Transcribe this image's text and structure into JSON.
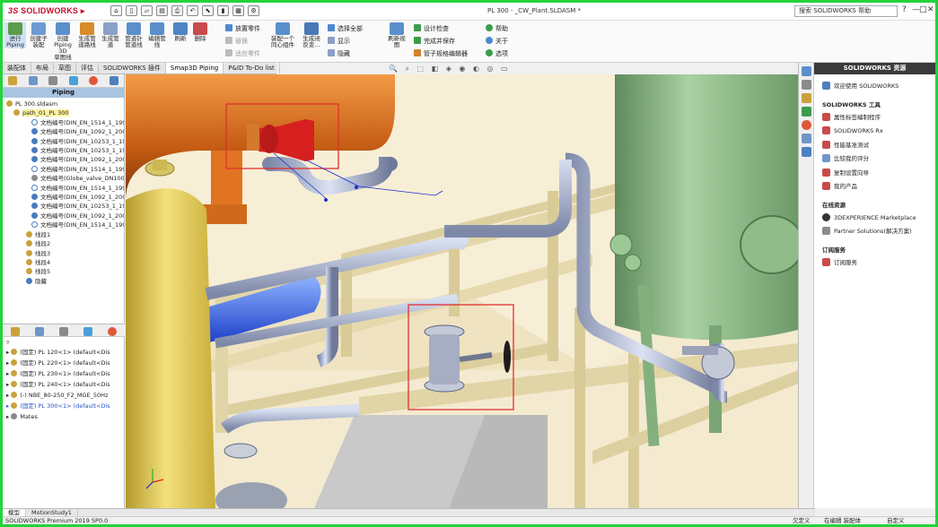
{
  "app": {
    "logo_ds": "3S",
    "logo_name": "SOLIDWORKS",
    "document_title": "PL 300 - _CW_Plant.SLDASM *",
    "search_placeholder": "搜索 SOLIDWORKS 帮助",
    "window_buttons": [
      "?",
      "—",
      "□",
      "✕"
    ]
  },
  "ribbon": {
    "buttons": [
      "进行\nPiping",
      "创建子\n装配",
      "创建\nPiping 3D\n草图线",
      "生成管\n道路线",
      "生成管\n道",
      "管道针\n管道线",
      "编辑管\n线",
      "刷新",
      "删除"
    ],
    "group1": [
      "放置零件",
      "替换",
      "适应零件"
    ],
    "button_pair": [
      "装配一个\n同心组件",
      "生成闭\n反变..."
    ],
    "group2": [
      "选择全部",
      "显示",
      "隐藏"
    ],
    "button_refresh": "刷新视\n图",
    "group3": [
      "设计检查",
      "完成并保存",
      "管子规格编辑器"
    ],
    "group4": [
      "帮助",
      "关于",
      "选项"
    ]
  },
  "tabs": [
    "装配体",
    "布局",
    "草图",
    "评估",
    "SOLIDWORKS 插件",
    "Smap3D Piping",
    "P&ID To-Do list"
  ],
  "left_panel": {
    "title": "Piping",
    "tree": [
      "PL 300.sldasm",
      "path_01_PL 300",
      "文档编号(DIN_EN_1514_1_199",
      "文档编号(DIN_EN_1092_1_200",
      "文档编号(DIN_EN_10253_1_19",
      "文档编号(DIN_EN_10253_1_19",
      "文档编号(DIN_EN_1092_1_200",
      "文档编号(DIN_EN_1514_1_199",
      "文档编号(Globe_valve_DN100_",
      "文档编号(DIN_EN_1514_1_199",
      "文档编号(DIN_EN_1092_1_200",
      "文档编号(DIN_EN_10253_1_19",
      "文档编号(DIN_EN_1092_1_200",
      "文档编号(DIN_EN_1514_1_199",
      "线段1",
      "线段2",
      "线段3",
      "线段4",
      "线段5",
      "隐藏"
    ],
    "components": [
      "(固定) PL 120<1> (default<Dis",
      "(固定) PL 220<1> (default<Dis",
      "(固定) PL 230<1> (default<Dis",
      "(固定) PL 240<1> (default<Dis",
      "(-) NBE_80-250_F2_MGE_50Hz",
      "(固定) PL 300<1> (default<Dis",
      "Mates"
    ]
  },
  "bottom_tabs": [
    "模型",
    "MotionStudy1"
  ],
  "status": {
    "left": "SOLIDWORKS Premium 2019 SP0.0",
    "right": [
      "欠定义",
      "在编辑 装配体",
      "自定义"
    ]
  },
  "right_panel": {
    "title": "SOLIDWORKS 资源",
    "welcome": "欢迎使用 SOLIDWORKS",
    "tools_header": "SOLIDWORKS 工具",
    "tools": [
      "属性标签编制程序",
      "SOLIDWORKS Rx",
      "性能基准测试",
      "比较我的评分",
      "复制设置向导",
      "我的产品"
    ],
    "online_header": "在线资源",
    "online": [
      "3DEXPERIENCE Marketplace",
      "Partner Solutions(解决方案)"
    ],
    "sub_header": "订阅服务",
    "sub": [
      "订阅服务"
    ]
  },
  "watermark": "Smap3D",
  "colors": {
    "frame": "#22d43a",
    "selection_box": "#e03030",
    "pipe": "#9aa6c2",
    "tank_green": "#8fbf8a",
    "tank_yellow": "#eedc70",
    "tank_orange": "#e9782a",
    "floor": "#f3e8c6"
  }
}
